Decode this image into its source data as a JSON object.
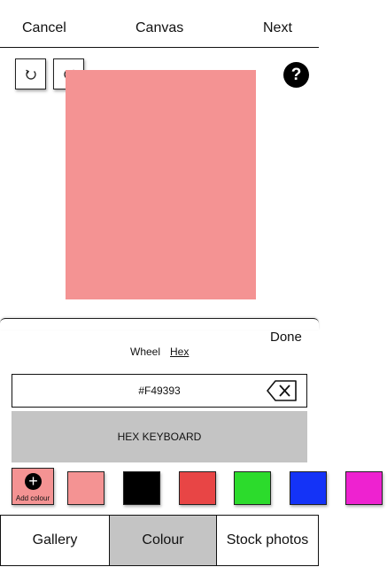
{
  "header": {
    "cancel": "Cancel",
    "title": "Canvas",
    "next": "Next"
  },
  "help": {
    "label": "?"
  },
  "canvas": {
    "color": "#F49393"
  },
  "picker": {
    "done": "Done",
    "tabs": {
      "wheel": "Wheel",
      "hex": "Hex",
      "active": "Hex"
    },
    "hex_value": "#F49393",
    "keyboard_label": "HEX KEYBOARD",
    "add_colour_label": "Add colour",
    "add_colour_icon": "+",
    "add_colour_fill": "#F49393",
    "swatches": [
      "#F49393",
      "#000000",
      "#E84545",
      "#2CDB2C",
      "#1433F7",
      "#EE22D0"
    ]
  },
  "bottom_tabs": {
    "gallery": "Gallery",
    "colour": "Colour",
    "stock": "Stock photos",
    "active": "Colour"
  }
}
